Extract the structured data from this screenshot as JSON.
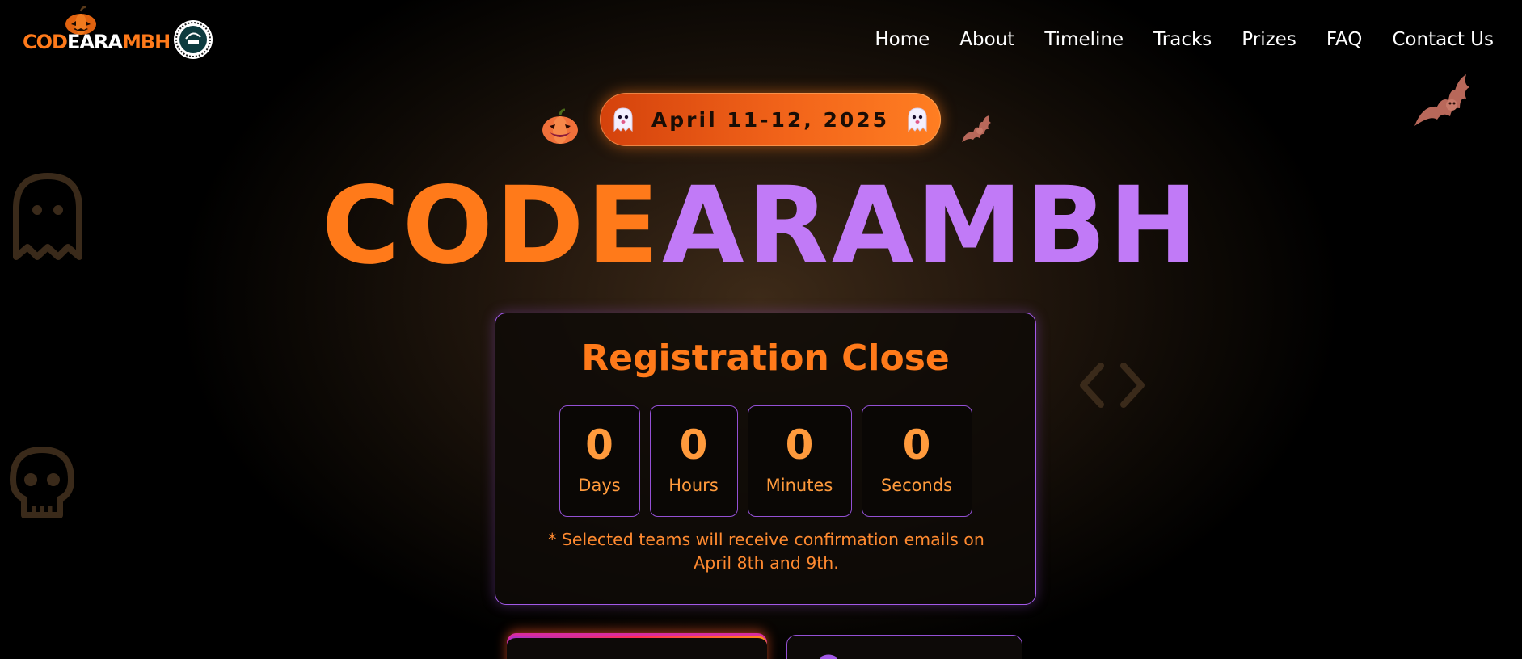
{
  "nav": {
    "brand": {
      "part1": "COD",
      "part2": "EARA",
      "part3": "MBH"
    },
    "links": [
      {
        "label": "Home"
      },
      {
        "label": "About"
      },
      {
        "label": "Timeline"
      },
      {
        "label": "Tracks"
      },
      {
        "label": "Prizes"
      },
      {
        "label": "FAQ"
      },
      {
        "label": "Contact Us"
      }
    ]
  },
  "hero": {
    "date": "April 11-12, 2025",
    "title_part1": "CODE",
    "title_part2": "ARAMBH"
  },
  "registration": {
    "title": "Registration Close",
    "countdown": [
      {
        "value": "0",
        "label": "Days"
      },
      {
        "value": "0",
        "label": "Hours"
      },
      {
        "value": "0",
        "label": "Minutes"
      },
      {
        "value": "0",
        "label": "Seconds"
      }
    ],
    "note": "* Selected teams will receive confirmation emails on April 8th and 9th."
  },
  "colors": {
    "accent_orange": "#ff7a1a",
    "accent_purple": "#c17af7",
    "card_border": "#a259e8",
    "background": "#000000"
  },
  "icons": [
    "pumpkin-icon",
    "bat-icon",
    "ghost-icon",
    "skull-icon",
    "code-brackets-icon"
  ]
}
